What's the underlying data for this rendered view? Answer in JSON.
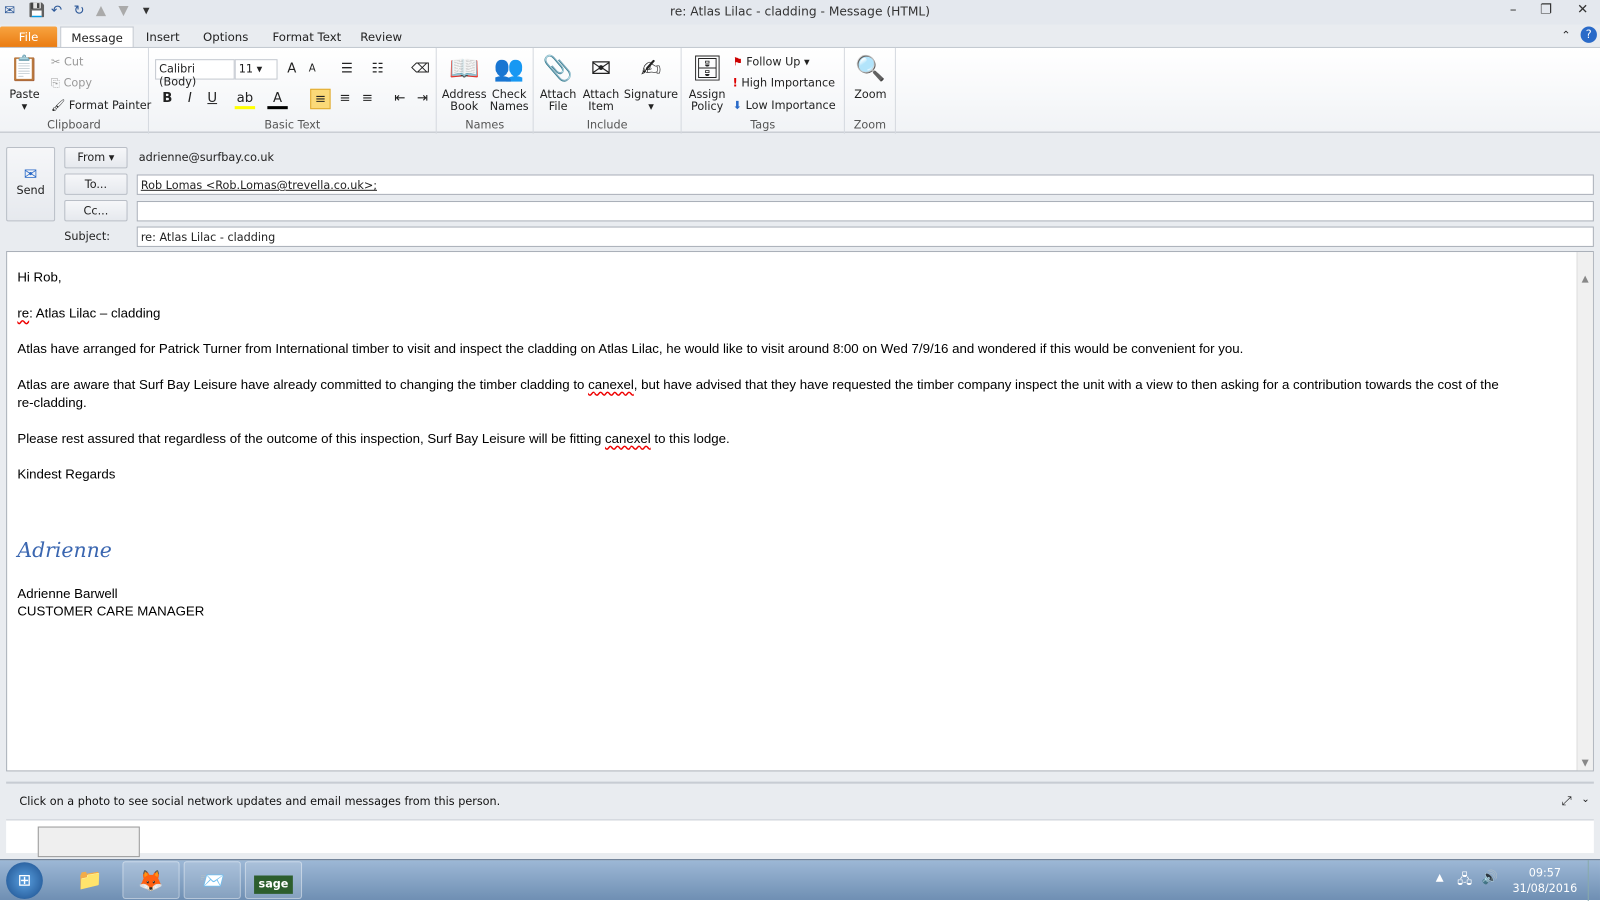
{
  "window": {
    "title": "re: Atlas Lilac - cladding  - Message (HTML)"
  },
  "quick_access": {
    "icons": [
      "outlook-icon",
      "save-icon",
      "undo-icon",
      "redo-icon",
      "up-icon",
      "down-icon",
      "customize-icon"
    ]
  },
  "tabs": [
    {
      "label": "File"
    },
    {
      "label": "Message"
    },
    {
      "label": "Insert"
    },
    {
      "label": "Options"
    },
    {
      "label": "Format Text"
    },
    {
      "label": "Review"
    }
  ],
  "ribbon": {
    "clipboard": {
      "label": "Clipboard",
      "paste": "Paste",
      "cut": "Cut",
      "copy": "Copy",
      "format_painter": "Format Painter"
    },
    "basic_text": {
      "label": "Basic Text",
      "font": "Calibri (Body)",
      "size": "11"
    },
    "names": {
      "label": "Names",
      "address_book": "Address Book",
      "check_names": "Check Names"
    },
    "include": {
      "label": "Include",
      "attach_file": "Attach File",
      "attach_item": "Attach Item",
      "signature": "Signature"
    },
    "tags": {
      "label": "Tags",
      "assign_policy": "Assign Policy",
      "follow_up": "Follow Up",
      "high": "High Importance",
      "low": "Low Importance"
    },
    "zoom": {
      "label": "Zoom",
      "zoom": "Zoom"
    }
  },
  "compose": {
    "send": "Send",
    "from_btn": "From",
    "from_value": "adrienne@surfbay.co.uk",
    "to_btn": "To...",
    "to_value": "Rob Lomas <Rob.Lomas@trevella.co.uk>;",
    "cc_btn": "Cc...",
    "cc_value": "",
    "subject_label": "Subject:",
    "subject_value": "re: Atlas Lilac - cladding"
  },
  "body": {
    "greeting": "Hi Rob,",
    "re_prefix": "re",
    "re_rest": ": Atlas Lilac – cladding",
    "p1": "Atlas have arranged for Patrick Turner from International timber to visit and inspect the cladding on Atlas Lilac, he would like to visit around 8:00 on Wed 7/9/16 and wondered if this would be convenient for you.",
    "p2a": "Atlas are aware that Surf Bay Leisure have already committed to changing the timber cladding to ",
    "canexel": "canexel",
    "p2b": ", but have advised that they have requested the timber company  inspect the unit with a view to then asking for a contribution towards the cost of the",
    "p2c": "re-cladding.",
    "p3a": "Please rest assured that regardless of the outcome of this inspection, Surf Bay Leisure will be fitting ",
    "p3b": " to this lodge.",
    "closing": "Kindest Regards",
    "signature_script": "Adrienne",
    "sig_name": "Adrienne Barwell",
    "sig_title": "CUSTOMER CARE MANAGER"
  },
  "people_pane": {
    "text": "Click on a photo to see social network updates and email messages from this person."
  },
  "taskbar": {
    "time": "09:57",
    "date": "31/08/2016"
  }
}
